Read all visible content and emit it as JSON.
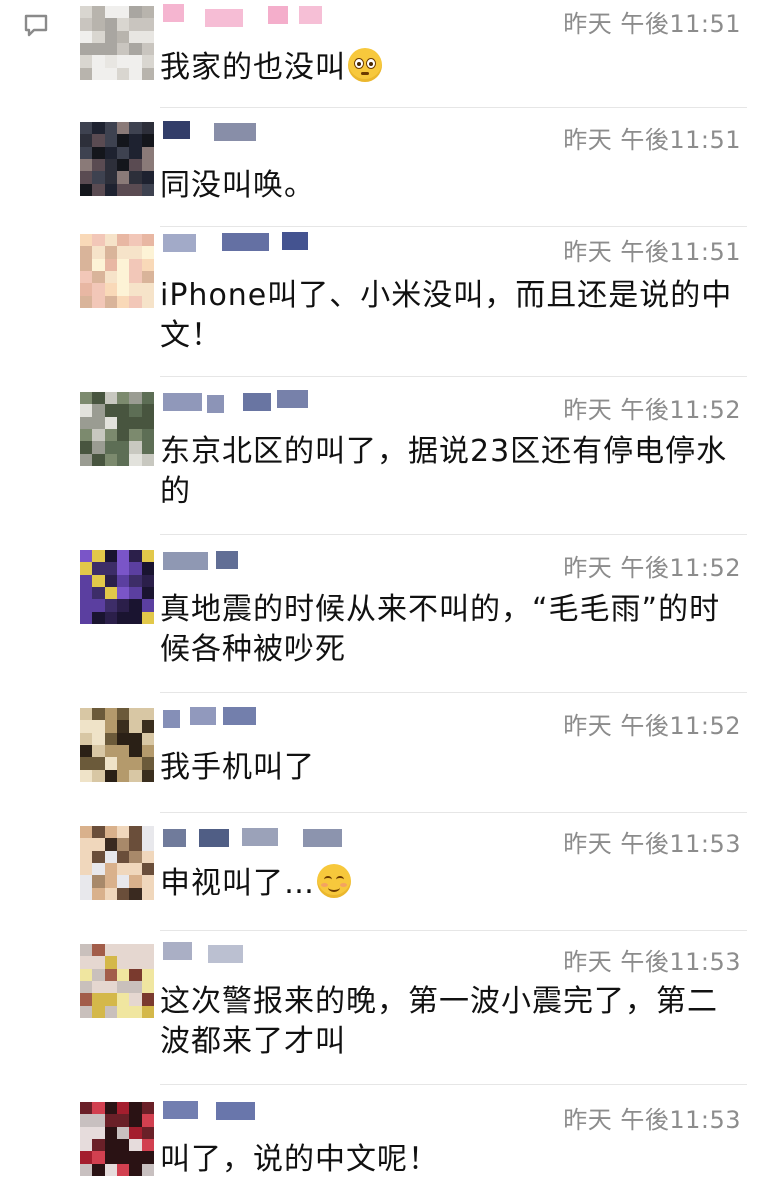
{
  "icons": {
    "chat": "chat-bubble-icon"
  },
  "colors": {
    "time_text": "#8c8c8c",
    "message_text": "#111111",
    "divider": "#e6e6e6",
    "emoji": "#f7c83c"
  },
  "messages": [
    {
      "time": "昨天 午後11:51",
      "text": "我家的也没叫",
      "emoji": "flushed-face"
    },
    {
      "time": "昨天 午後11:51",
      "text": "同没叫唤。",
      "emoji": null
    },
    {
      "time": "昨天 午後11:51",
      "text": "iPhone叫了、小米没叫，而且还是说的中文！",
      "emoji": null
    },
    {
      "time": "昨天 午後11:52",
      "text": "东京北区的叫了，据说23区还有停电停水的",
      "emoji": null
    },
    {
      "time": "昨天 午後11:52",
      "text": "真地震的时候从来不叫的，“毛毛雨”的时候各种被吵死",
      "emoji": null
    },
    {
      "time": "昨天 午後11:52",
      "text": "我手机叫了",
      "emoji": null
    },
    {
      "time": "昨天 午後11:53",
      "text": "申视叫了…",
      "emoji": "smiling-face"
    },
    {
      "time": "昨天 午後11:53",
      "text": "这次警报来的晚，第一波小震完了，第二波都来了才叫",
      "emoji": null
    },
    {
      "time": "昨天 午後11:53",
      "text": "叫了，说的中文呢！",
      "emoji": null
    }
  ]
}
